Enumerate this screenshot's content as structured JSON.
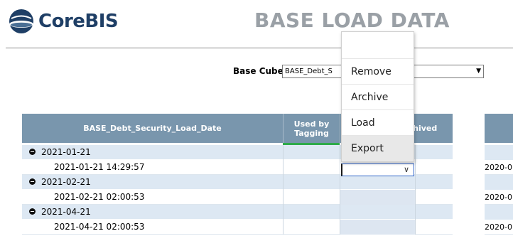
{
  "header": {
    "logo_text": "CoreBIS",
    "title": "BASE LOAD DATA"
  },
  "filter": {
    "label": "Base Cube",
    "selected_value": "BASE_Debt_S"
  },
  "table": {
    "columns": [
      "BASE_Debt_Security_Load_Date",
      "Used by Tagging",
      "Archived"
    ],
    "rows": [
      {
        "type": "group",
        "label": "2021-01-21"
      },
      {
        "type": "leaf",
        "label": "2021-01-21 14:29:57"
      },
      {
        "type": "group",
        "label": "2021-02-21"
      },
      {
        "type": "leaf",
        "label": "2021-02-21 02:00:53"
      },
      {
        "type": "group",
        "label": "2021-04-21"
      },
      {
        "type": "leaf",
        "label": "2021-04-21 02:00:53"
      }
    ]
  },
  "right_panel": {
    "rows": [
      "",
      "2020-0",
      "",
      "2020-0",
      "",
      "2020-0"
    ]
  },
  "menu": {
    "items": [
      "Remove",
      "Archive",
      "Load",
      "Export"
    ],
    "highlighted": "Export"
  }
}
